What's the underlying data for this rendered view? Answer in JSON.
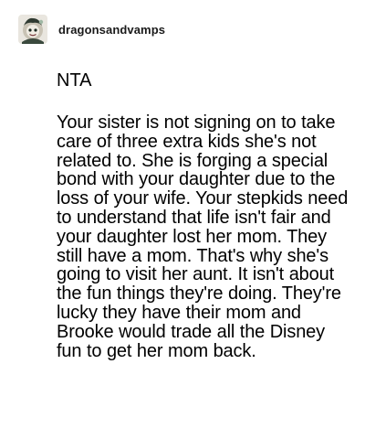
{
  "post": {
    "username": "dragonsandvamps",
    "verdict": "NTA",
    "body": "Your sister is not signing on to take care of three extra kids she's not related to. She is forging a special bond with your daughter due to the loss of your wife. Your stepkids need to understand that life isn't fair and your daughter lost her mom. They still have a mom. That's why she's going to visit her aunt. It isn't about the fun things they're doing. They're lucky they have their mom and Brooke would trade all the Disney fun to get her mom back."
  },
  "colors": {
    "background": "#ffffff",
    "text": "#000000",
    "avatar_bg": "#e9e6df",
    "avatar_face": "#3b4a3e"
  },
  "icons": {
    "avatar": "avatar-icon"
  }
}
